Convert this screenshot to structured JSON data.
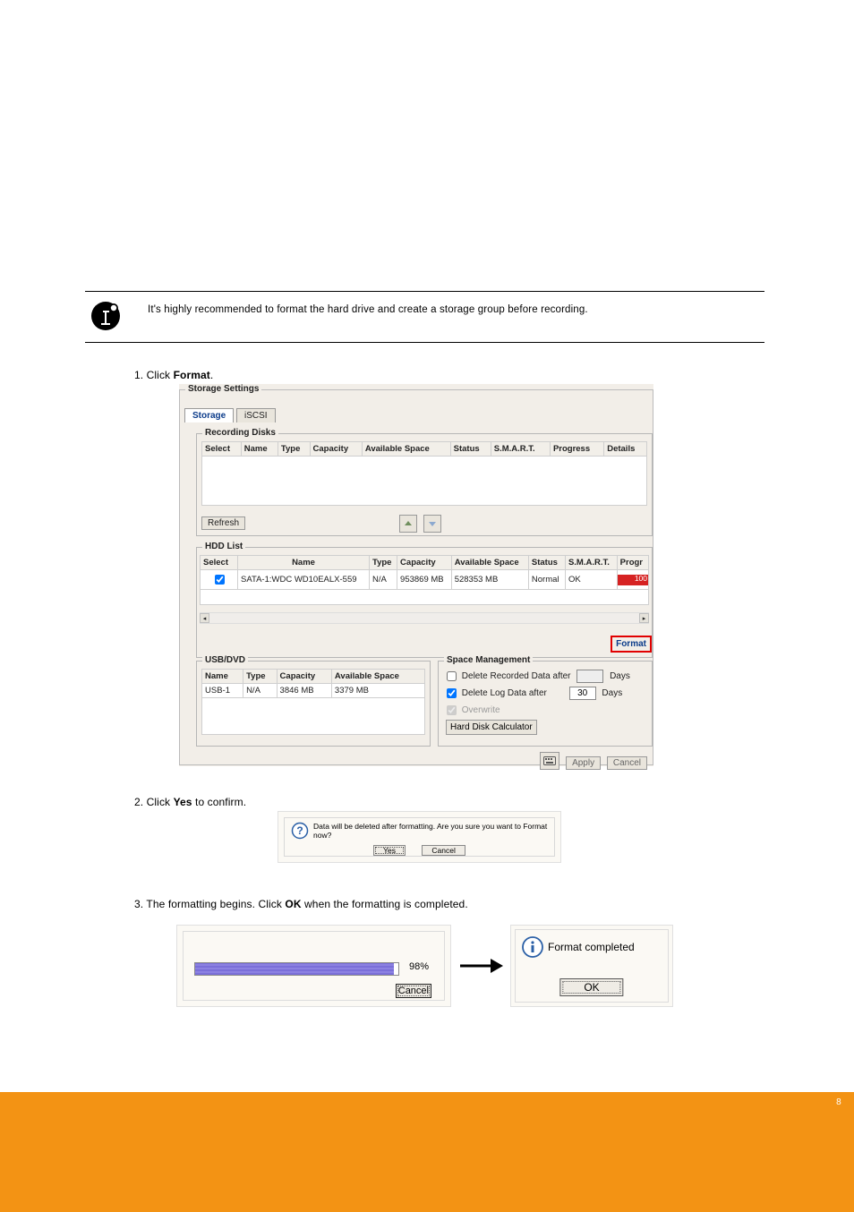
{
  "info_text": "It's highly recommended to format the hard drive and create a storage group before recording.",
  "step1": {
    "label": "1. Click ",
    "bold": "Format",
    "tail": "."
  },
  "step2": {
    "label": "2. Click ",
    "bold": "Yes",
    "tail": " to confirm."
  },
  "step3": {
    "label": "3. The formatting begins. Click ",
    "bold": "OK",
    "tail": " when the formatting is completed."
  },
  "storage": {
    "title": "Storage Settings",
    "tabs": {
      "active": "Storage",
      "inactive": "iSCSI"
    },
    "recording": {
      "legend": "Recording Disks",
      "headers": [
        "Select",
        "Name",
        "Type",
        "Capacity",
        "Available Space",
        "Status",
        "S.M.A.R.T.",
        "Progress",
        "Details"
      ],
      "refresh_label": "Refresh"
    },
    "hdd": {
      "legend": "HDD List",
      "headers": [
        "Select",
        "Name",
        "Type",
        "Capacity",
        "Available Space",
        "Status",
        "S.M.A.R.T.",
        "Progr"
      ],
      "row": {
        "checked": true,
        "name": "SATA-1:WDC WD10EALX-559",
        "type": "N/A",
        "capacity": "953869 MB",
        "available": "528353 MB",
        "status": "Normal",
        "smart": "OK",
        "progress_pct": "100"
      },
      "format_label": "Format"
    },
    "usb": {
      "legend": "USB/DVD",
      "headers": [
        "Name",
        "Type",
        "Capacity",
        "Available Space"
      ],
      "row": {
        "name": "USB-1",
        "type": "N/A",
        "capacity": "3846 MB",
        "available": "3379 MB"
      }
    },
    "space": {
      "legend": "Space Management",
      "delete_recorded": {
        "checked": false,
        "label": "Delete Recorded Data after",
        "value": "",
        "unit": "Days"
      },
      "delete_log": {
        "checked": true,
        "label": "Delete Log Data after",
        "value": "30",
        "unit": "Days"
      },
      "overwrite": {
        "checked": true,
        "label": "Overwrite"
      },
      "hd_calc": "Hard Disk Calculator"
    },
    "bottom": {
      "apply": "Apply",
      "cancel": "Cancel"
    }
  },
  "confirm_dialog": {
    "message": "Data will be deleted after formatting. Are you sure you want to Format now?",
    "yes": "Yes",
    "cancel": "Cancel"
  },
  "progress_dialog": {
    "percent": "98%",
    "cancel": "Cancel"
  },
  "complete_dialog": {
    "message": "Format completed",
    "ok": "OK"
  },
  "footer_page": "8"
}
